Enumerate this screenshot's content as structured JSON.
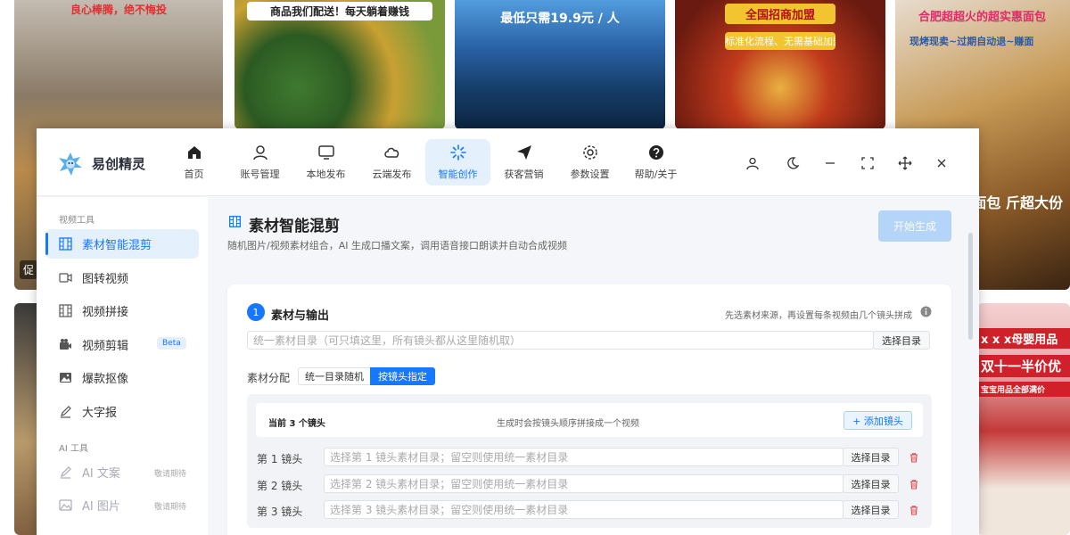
{
  "background": {
    "thumb1_caption": "良心棒腾，绝不悔投",
    "thumb1_tag": "促",
    "thumb2_caption": "商品我们配送！每天躺着赚钱",
    "thumb3_caption": "最低只需19.9元 / 人",
    "thumb4_caption": "全国招商加盟",
    "thumb4_sub": "标准化流程、无需基础加盟",
    "thumb5_caption": "合肥超超火的超实惠面包",
    "thumb5_sub": "现烤现卖~过期自动退~赚面",
    "thumb5_side": "式小面包 斤超大份",
    "thumb7_caption": "x x x母婴用品",
    "thumb7_sub": "双十一半价优",
    "thumb7_small": "宝宝用品全部满价"
  },
  "app": {
    "name": "易创精灵",
    "nav": [
      {
        "label": "首页",
        "icon": "home-icon"
      },
      {
        "label": "账号管理",
        "icon": "user-icon"
      },
      {
        "label": "本地发布",
        "icon": "monitor-icon"
      },
      {
        "label": "云端发布",
        "icon": "cloud-icon"
      },
      {
        "label": "智能创作",
        "icon": "sparkle-icon"
      },
      {
        "label": "获客营销",
        "icon": "send-icon"
      },
      {
        "label": "参数设置",
        "icon": "gear-icon"
      },
      {
        "label": "帮助/关于",
        "icon": "help-icon"
      }
    ],
    "active_nav": "智能创作"
  },
  "sidebar": {
    "section1": "视频工具",
    "items": [
      {
        "label": "素材智能混剪",
        "icon": "grid-film-icon"
      },
      {
        "label": "图转视频",
        "icon": "video-icon"
      },
      {
        "label": "视频拼接",
        "icon": "film-icon"
      },
      {
        "label": "视频剪辑",
        "icon": "camera-icon",
        "badge": "Beta"
      },
      {
        "label": "爆款抠像",
        "icon": "image-icon"
      },
      {
        "label": "大字报",
        "icon": "pen-icon"
      }
    ],
    "section2": "AI 工具",
    "ai_items": [
      {
        "label": "AI 文案",
        "icon": "pen-icon",
        "note": "敬请期待"
      },
      {
        "label": "AI 图片",
        "icon": "image-icon",
        "note": "敬请期待"
      }
    ]
  },
  "main": {
    "title": "素材智能混剪",
    "description": "随机图片/视频素材组合，AI 生成口播文案，调用语音接口朗读并自动合成视频",
    "primary_button": "开始生成",
    "step": {
      "number": "1",
      "title": "素材与输出",
      "hint": "先选素材来源，再设置每条视频由几个镜头拼成",
      "unified_dir_placeholder": "统一素材目录（可只填这里，所有镜头都从这里随机取）",
      "select_dir_label": "选择目录",
      "distribution_label": "素材分配",
      "mode_unified": "统一目录随机",
      "mode_by_shot": "按镜头指定",
      "shots_count": "当前 3 个镜头",
      "shots_note": "生成时会按镜头顺序拼接成一个视频",
      "add_shot": "+ 添加镜头",
      "shots": [
        {
          "label": "第 1 镜头",
          "placeholder": "选择第 1 镜头素材目录；留空则使用统一素材目录"
        },
        {
          "label": "第 2 镜头",
          "placeholder": "选择第 2 镜头素材目录；留空则使用统一素材目录"
        },
        {
          "label": "第 3 镜头",
          "placeholder": "选择第 3 镜头素材目录；留空则使用统一素材目录"
        }
      ]
    }
  },
  "colors": {
    "accent": "#1677ff",
    "delete": "#e0474c"
  }
}
